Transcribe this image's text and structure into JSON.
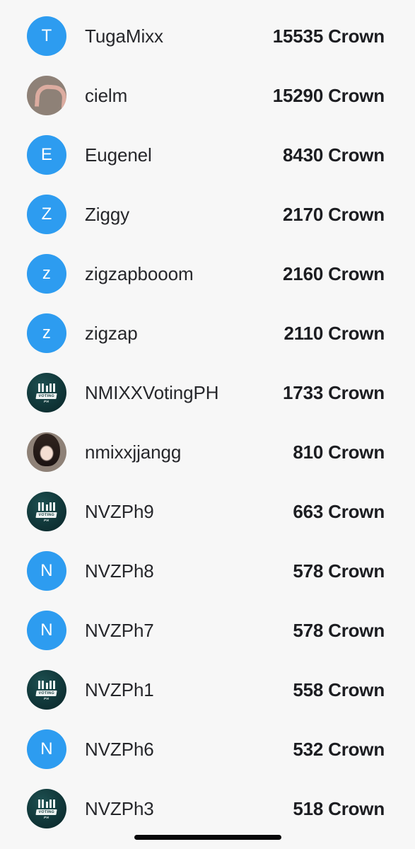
{
  "screen": {
    "background_color": "#f7f7f7",
    "accent_color": "#2d9cf0",
    "text_color": "#26272b",
    "score_color": "#1c1d21"
  },
  "leaderboard": {
    "score_unit": "Crown",
    "rows": [
      {
        "name": "TugaMixx",
        "score": "15535 Crown",
        "avatar_type": "letter",
        "avatar_initial": "T"
      },
      {
        "name": "cielm",
        "score": "15290 Crown",
        "avatar_type": "photo-heart",
        "avatar_initial": ""
      },
      {
        "name": "Eugenel",
        "score": "8430 Crown",
        "avatar_type": "letter",
        "avatar_initial": "E"
      },
      {
        "name": "Ziggy",
        "score": "2170 Crown",
        "avatar_type": "letter",
        "avatar_initial": "Z"
      },
      {
        "name": "zigzapbooom",
        "score": "2160 Crown",
        "avatar_type": "letter",
        "avatar_initial": "z"
      },
      {
        "name": "zigzap",
        "score": "2110 Crown",
        "avatar_type": "letter",
        "avatar_initial": "z"
      },
      {
        "name": "NMIXXVotingPH",
        "score": "1733 Crown",
        "avatar_type": "logo",
        "avatar_initial": ""
      },
      {
        "name": "nmixxjjangg",
        "score": "810 Crown",
        "avatar_type": "photo-portrait",
        "avatar_initial": ""
      },
      {
        "name": "NVZPh9",
        "score": "663 Crown",
        "avatar_type": "logo",
        "avatar_initial": ""
      },
      {
        "name": "NVZPh8",
        "score": "578 Crown",
        "avatar_type": "letter",
        "avatar_initial": "N"
      },
      {
        "name": "NVZPh7",
        "score": "578 Crown",
        "avatar_type": "letter",
        "avatar_initial": "N"
      },
      {
        "name": "NVZPh1",
        "score": "558 Crown",
        "avatar_type": "logo",
        "avatar_initial": ""
      },
      {
        "name": "NVZPh6",
        "score": "532 Crown",
        "avatar_type": "letter",
        "avatar_initial": "N"
      },
      {
        "name": "NVZPh3",
        "score": "518 Crown",
        "avatar_type": "logo",
        "avatar_initial": ""
      }
    ]
  },
  "logo_avatar": {
    "wordmark": "NMIXX",
    "badge": "VOTING",
    "subtitle": "PH"
  },
  "system": {
    "home_indicator": "home-indicator"
  }
}
